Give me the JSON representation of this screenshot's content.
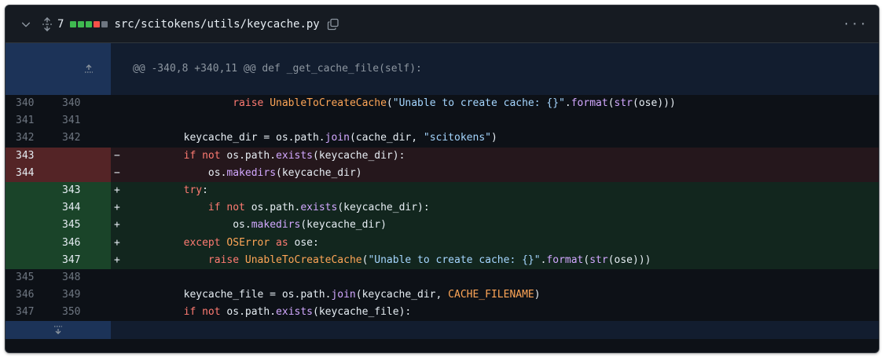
{
  "file": {
    "change_count": "7",
    "path": "src/scitokens/utils/keycache.py",
    "diffstat_colors": [
      "#3fb950",
      "#3fb950",
      "#3fb950",
      "#f85149",
      "#6e7681"
    ]
  },
  "hunk_header": "@@ -340,8 +340,11 @@ def _get_cache_file(self):",
  "lines": [
    {
      "type": "ctx",
      "old": "340",
      "new": "340",
      "marker": "",
      "tokens": [
        {
          "t": "                "
        },
        {
          "t": "raise ",
          "c": "kw"
        },
        {
          "t": "UnableToCreateCache",
          "c": "cst"
        },
        {
          "t": "("
        },
        {
          "t": "\"Unable to create cache: {}\"",
          "c": "str"
        },
        {
          "t": "."
        },
        {
          "t": "format",
          "c": "fn"
        },
        {
          "t": "("
        },
        {
          "t": "str",
          "c": "fn"
        },
        {
          "t": "(ose)))"
        }
      ]
    },
    {
      "type": "ctx",
      "old": "341",
      "new": "341",
      "marker": "",
      "tokens": []
    },
    {
      "type": "ctx",
      "old": "342",
      "new": "342",
      "marker": "",
      "tokens": [
        {
          "t": "        keycache_dir = os.path."
        },
        {
          "t": "join",
          "c": "fn"
        },
        {
          "t": "(cache_dir, "
        },
        {
          "t": "\"scitokens\"",
          "c": "str"
        },
        {
          "t": ")"
        }
      ]
    },
    {
      "type": "del",
      "old": "343",
      "new": "",
      "marker": "−",
      "tokens": [
        {
          "t": "        "
        },
        {
          "t": "if not ",
          "c": "kw"
        },
        {
          "t": "os.path."
        },
        {
          "t": "exists",
          "c": "fn"
        },
        {
          "t": "(keycache_dir):"
        }
      ]
    },
    {
      "type": "del",
      "old": "344",
      "new": "",
      "marker": "−",
      "tokens": [
        {
          "t": "            os."
        },
        {
          "t": "makedirs",
          "c": "fn"
        },
        {
          "t": "(keycache_dir)"
        }
      ]
    },
    {
      "type": "add",
      "old": "",
      "new": "343",
      "marker": "+",
      "tokens": [
        {
          "t": "        "
        },
        {
          "t": "try",
          "c": "kw"
        },
        {
          "t": ":"
        }
      ]
    },
    {
      "type": "add",
      "old": "",
      "new": "344",
      "marker": "+",
      "tokens": [
        {
          "t": "            "
        },
        {
          "t": "if not ",
          "c": "kw"
        },
        {
          "t": "os.path."
        },
        {
          "t": "exists",
          "c": "fn"
        },
        {
          "t": "(keycache_dir):"
        }
      ]
    },
    {
      "type": "add",
      "old": "",
      "new": "345",
      "marker": "+",
      "tokens": [
        {
          "t": "                os."
        },
        {
          "t": "makedirs",
          "c": "fn"
        },
        {
          "t": "(keycache_dir)"
        }
      ]
    },
    {
      "type": "add",
      "old": "",
      "new": "346",
      "marker": "+",
      "tokens": [
        {
          "t": "        "
        },
        {
          "t": "except ",
          "c": "kw"
        },
        {
          "t": "OSError",
          "c": "cst"
        },
        {
          "t": " as ",
          "c": "kw"
        },
        {
          "t": "ose:"
        }
      ]
    },
    {
      "type": "add",
      "old": "",
      "new": "347",
      "marker": "+",
      "tokens": [
        {
          "t": "            "
        },
        {
          "t": "raise ",
          "c": "kw"
        },
        {
          "t": "UnableToCreateCache",
          "c": "cst"
        },
        {
          "t": "("
        },
        {
          "t": "\"Unable to create cache: {}\"",
          "c": "str"
        },
        {
          "t": "."
        },
        {
          "t": "format",
          "c": "fn"
        },
        {
          "t": "("
        },
        {
          "t": "str",
          "c": "fn"
        },
        {
          "t": "(ose)))"
        }
      ]
    },
    {
      "type": "ctx",
      "old": "345",
      "new": "348",
      "marker": "",
      "tokens": []
    },
    {
      "type": "ctx",
      "old": "346",
      "new": "349",
      "marker": "",
      "tokens": [
        {
          "t": "        keycache_file = os.path."
        },
        {
          "t": "join",
          "c": "fn"
        },
        {
          "t": "(keycache_dir, "
        },
        {
          "t": "CACHE_FILENAME",
          "c": "cst"
        },
        {
          "t": ")"
        }
      ]
    },
    {
      "type": "ctx",
      "old": "347",
      "new": "350",
      "marker": "",
      "tokens": [
        {
          "t": "        "
        },
        {
          "t": "if not ",
          "c": "kw"
        },
        {
          "t": "os.path."
        },
        {
          "t": "exists",
          "c": "fn"
        },
        {
          "t": "(keycache_file):"
        }
      ]
    }
  ],
  "icons": {
    "collapse": "chevron-down-icon",
    "expand_all": "unfold-icon",
    "copy": "copy-icon",
    "more": "kebab-horizontal-icon",
    "expand_up": "expand-up-icon",
    "expand_down": "expand-down-icon"
  },
  "colors": {
    "background": "#0d1117",
    "deletion_line": "#25171c",
    "deletion_gutter": "#542426",
    "addition_line": "#12261e",
    "addition_gutter": "#1a4429",
    "hunk_line": "#121d2f",
    "hunk_gutter": "#1c3358"
  }
}
